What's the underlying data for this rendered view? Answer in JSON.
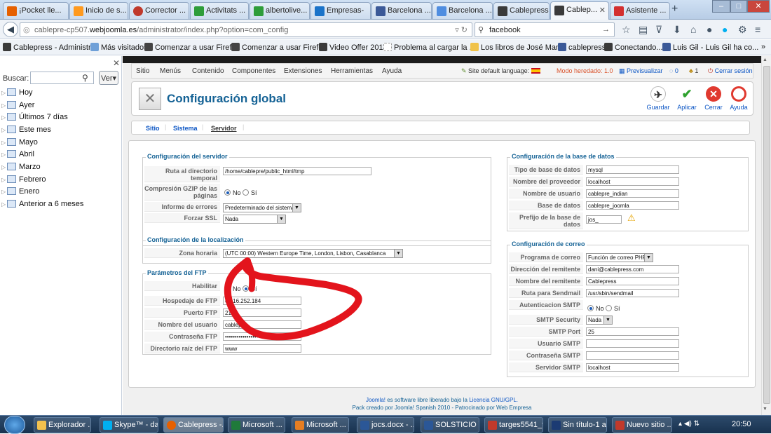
{
  "browser": {
    "tabs": [
      {
        "title": "¡Pocket lle...",
        "color": "#e66000"
      },
      {
        "title": "Inicio de s...",
        "color": "#ff9a1f"
      },
      {
        "title": "Corrector ...",
        "color": "#c0392b"
      },
      {
        "title": "Activitats ...",
        "color": "#2e9d3a"
      },
      {
        "title": "albertolive...",
        "color": "#2e9d3a"
      },
      {
        "title": "Empresas-",
        "color": "#1a73c9"
      },
      {
        "title": "Barcelona ...",
        "color": "#3b5998"
      },
      {
        "title": "Barcelona ...",
        "color": "#4f8de0"
      },
      {
        "title": "Cablepress...",
        "color": "#3a3a3a"
      },
      {
        "title": "Cablep...",
        "color": "#3a3a3a",
        "active": true
      },
      {
        "title": "Asistente ...",
        "color": "#d32f2f"
      }
    ],
    "new_tab": "+",
    "url_prefix": "cablepre-cp507.",
    "url_domain": "webjoomla.es",
    "url_path": "/administrator/index.php?option=com_config",
    "search_value": "facebook",
    "bookmarks": [
      "Cablepress - Administr...",
      "Más visitados",
      "Comenzar a usar Firefox",
      "Comenzar a usar Firefox",
      "Video Offer 2014",
      "Problema al cargar la ...",
      "Los libros de José Man...",
      "cablepress",
      "Conectando...",
      "Luis Gil - Luis Gil ha co..."
    ]
  },
  "sidebar": {
    "search_label": "Buscar:",
    "search_value": "",
    "view_button": "Ver",
    "items": [
      "Hoy",
      "Ayer",
      "Últimos 7 días",
      "Este mes",
      "Mayo",
      "Abril",
      "Marzo",
      "Febrero",
      "Enero",
      "Anterior a 6 meses"
    ]
  },
  "joomla": {
    "menu": [
      "Sitio",
      "Menús",
      "Contenido",
      "Componentes",
      "Extensiones",
      "Herramientas",
      "Ayuda"
    ],
    "status": {
      "site_lang": "Site default language:",
      "mode": "Modo heredado: 1.0",
      "preview": "Previsualizar",
      "count_a": "0",
      "count_b": "1",
      "logout": "Cerrar sesión"
    },
    "page_title": "Configuración global",
    "toolbar": [
      "Guardar",
      "Aplicar",
      "Cerrar",
      "Ayuda"
    ],
    "subtabs": [
      "Sitio",
      "Sistema",
      "Servidor"
    ],
    "server": {
      "legend": "Configuración del servidor",
      "tmp_label_1": "Ruta al directorio",
      "tmp_label_2": "temporal",
      "tmp_value": "/home/cablepre/public_html/tmp",
      "gzip_label_1": "Compresión GZIP de las",
      "gzip_label_2": "páginas",
      "no": "No",
      "yes": "Sí",
      "errors_label": "Informe de errores",
      "errors_value": "Predeterminado del sistema",
      "ssl_label": "Forzar SSL",
      "ssl_value": "Nada"
    },
    "locale": {
      "legend": "Configuración de la localización",
      "tz_label": "Zona horaria",
      "tz_value": "(UTC 00:00) Western Europe Time, London, Lisbon, Casablanca"
    },
    "ftp": {
      "legend": "Parámetros del FTP",
      "enable_label": "Habilitar",
      "host_label": "Hospedaje de FTP",
      "host_value": "69.16.252.184",
      "port_label": "Puerto FTP",
      "port_value": "21",
      "user_label": "Nombre del usuario",
      "user_value": "cablepre",
      "pass_label": "Contraseña FTP",
      "pass_value": "••••••••••••••••••••••",
      "root_label": "Directorio raíz del FTP",
      "root_value": "www"
    },
    "database": {
      "legend": "Configuración de la base de datos",
      "type_label": "Tipo de base de datos",
      "type_value": "mysql",
      "host_label": "Nombre del proveedor",
      "host_value": "localhost",
      "user_label": "Nombre de usuario",
      "user_value": "cablepre_indian",
      "db_label": "Base de datos",
      "db_value": "cablepre_joomla",
      "prefix_label_1": "Prefijo de la base de",
      "prefix_label_2": "datos",
      "prefix_value": "jos_"
    },
    "mail": {
      "legend": "Configuración de correo",
      "program_label": "Programa de correo",
      "program_value": "Función de correo PHP",
      "from_label": "Dirección del remitente",
      "from_value": "dani@cablepress.com",
      "fromname_label": "Nombre del remitente",
      "fromname_value": "Cablepress",
      "sendmail_label": "Ruta para Sendmail",
      "sendmail_value": "/usr/sbin/sendmail",
      "smtpauth_label": "Autenticacion SMTP",
      "security_label": "SMTP Security",
      "security_value": "Nada",
      "port_label": "SMTP Port",
      "port_value": "25",
      "user_label": "Usuario SMTP",
      "user_value": "",
      "pass_label": "Contraseña SMTP",
      "pass_value": "",
      "server_label": "Servidor SMTP",
      "server_value": "localhost"
    },
    "footer_line1_a": "Joomla!",
    "footer_line1_b": " es software libre liberado bajo la ",
    "footer_line1_c": "Licencia GNU/GPL.",
    "footer_line2": "Pack creado por Joomla! Spanish 2010 - Patrocinado por Web Empresa"
  },
  "taskbar": {
    "items": [
      {
        "title": "Explorador ...",
        "color": "#f2c14e"
      },
      {
        "title": "Skype™ - da...",
        "color": "#00aff0"
      },
      {
        "title": "Cablepress -...",
        "color": "#e66000",
        "active": true
      },
      {
        "title": "Microsoft ...",
        "color": "#1f7a3a"
      },
      {
        "title": "Microsoft ...",
        "color": "#e67e22"
      },
      {
        "title": "jocs.docx - ...",
        "color": "#2b5797"
      },
      {
        "title": "SOLSTICIO V...",
        "color": "#2b5797"
      },
      {
        "title": "targes5541_9...",
        "color": "#c0392b"
      },
      {
        "title": "Sin título-1 a...",
        "color": "#1c3b73"
      },
      {
        "title": "Nuevo sitio ...",
        "color": "#c0392b"
      }
    ],
    "clock": "20:50"
  }
}
